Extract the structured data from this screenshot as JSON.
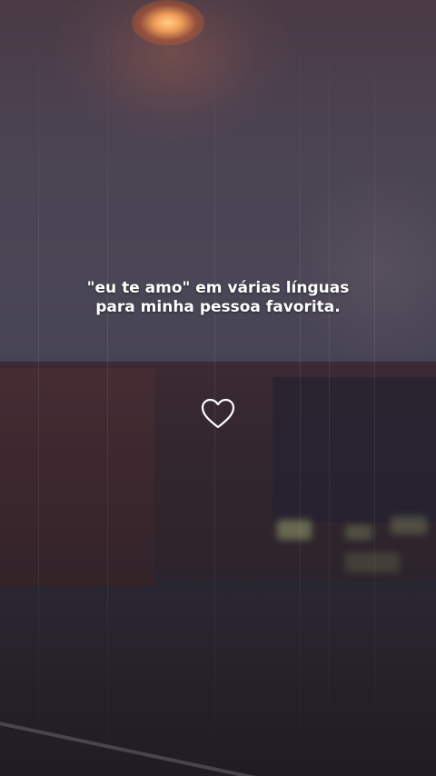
{
  "caption": {
    "line1": "\"eu te amo\" em várias línguas",
    "line2": "para minha pessoa favorita."
  },
  "heart_icon": "heart-outline-icon",
  "colors": {
    "text": "#ffffff",
    "heart_stroke": "#ffffff"
  }
}
